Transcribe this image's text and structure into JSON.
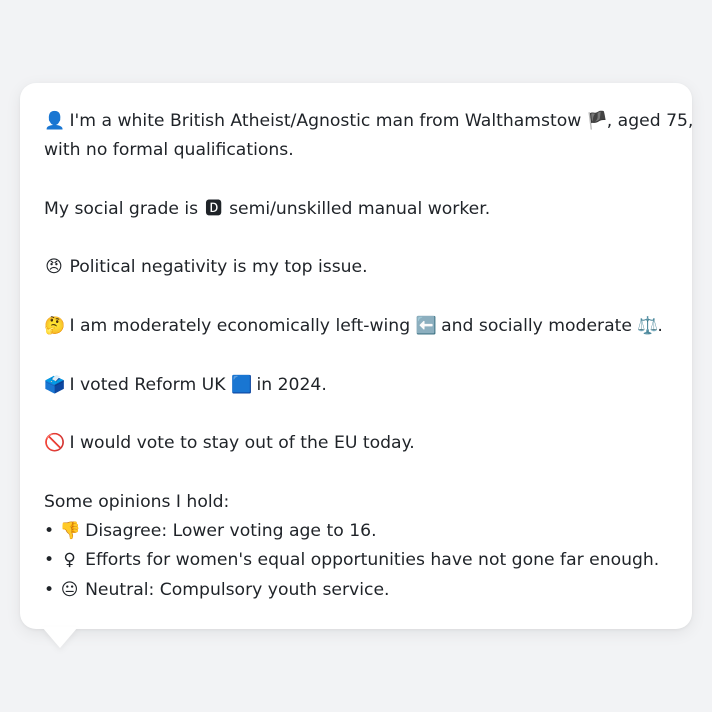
{
  "bio": {
    "intro_icon": "👤",
    "intro_text_1": "I'm a white British Atheist/Agnostic man from Walthamstow",
    "flag_icon": "🏴",
    "intro_text_2": ", aged 75,",
    "intro_text_3": "with no formal qualifications.",
    "grade_text_1": "My social grade is",
    "grade_icon": "🅳",
    "grade_text_2": "semi/unskilled manual worker.",
    "issue_icon": "😠",
    "issue_text": "Political negativity is my top issue.",
    "position_icon": "🤔",
    "position_text_1": "I am moderately economically left-wing",
    "left_icon": "⬅️",
    "position_text_2": "and socially moderate",
    "scales_icon": "⚖️",
    "position_text_3": ".",
    "vote_icon": "🗳️",
    "vote_text_1": "I voted Reform UK",
    "party_icon": "🟦",
    "vote_text_2": "in 2024.",
    "eu_icon": "🚫",
    "eu_text": "I would vote to stay out of the EU today."
  },
  "opinions": {
    "heading": "Some opinions I hold:",
    "bullet": "•",
    "items": [
      {
        "icon": "👎",
        "text": "Disagree: Lower voting age to 16."
      },
      {
        "icon": "♀",
        "text": "Efforts for women's equal opportunities have not gone far enough."
      },
      {
        "icon": "😐",
        "text": "Neutral: Compulsory youth service."
      }
    ]
  }
}
